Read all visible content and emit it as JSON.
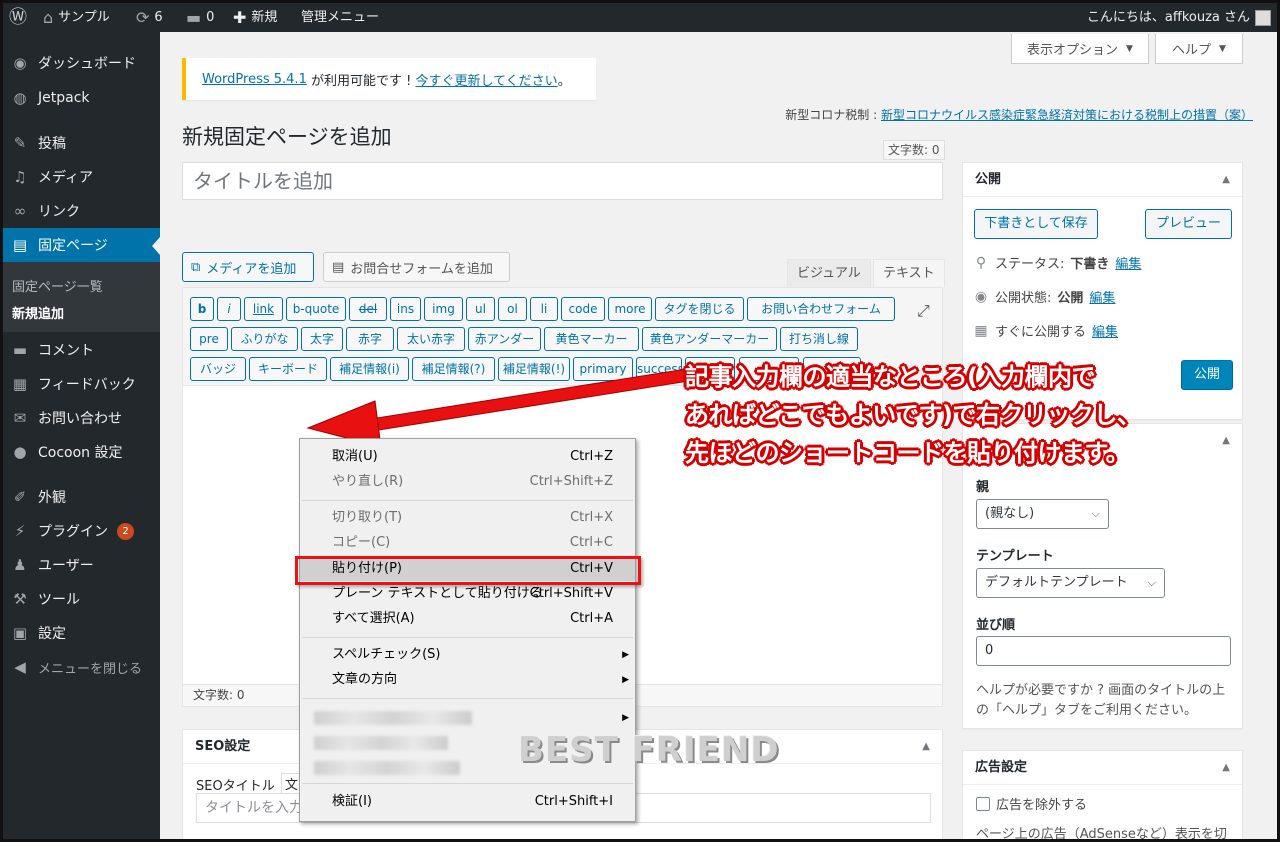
{
  "adminbar": {
    "site_name": "サンプル",
    "updates_count": "6",
    "comments_count": "0",
    "new_label": "新規",
    "admin_menu_label": "管理メニュー",
    "greeting": "こんにちは、affkouza さん"
  },
  "sidebar": {
    "items": [
      {
        "label": "ダッシュボード",
        "icon": "dashboard-icon"
      },
      {
        "label": "Jetpack",
        "icon": "jetpack-icon"
      },
      {
        "label": "投稿",
        "icon": "pin-icon"
      },
      {
        "label": "メディア",
        "icon": "media-icon"
      },
      {
        "label": "リンク",
        "icon": "link-icon"
      },
      {
        "label": "固定ページ",
        "icon": "page-icon"
      },
      {
        "label": "コメント",
        "icon": "comment-icon"
      },
      {
        "label": "フィードバック",
        "icon": "feedback-icon"
      },
      {
        "label": "お問い合わせ",
        "icon": "mail-icon"
      },
      {
        "label": "Cocoon 設定",
        "icon": "cocoon-icon"
      },
      {
        "label": "外観",
        "icon": "appearance-icon"
      },
      {
        "label": "プラグイン",
        "icon": "plugin-icon",
        "badge": "2"
      },
      {
        "label": "ユーザー",
        "icon": "user-icon"
      },
      {
        "label": "ツール",
        "icon": "tool-icon"
      },
      {
        "label": "設定",
        "icon": "settings-icon"
      },
      {
        "label": "メニューを閉じる",
        "icon": "collapse-icon"
      }
    ],
    "submenu": [
      "固定ページ一覧",
      "新規追加"
    ]
  },
  "screen_options": {
    "label": "表示オプション",
    "help": "ヘルプ"
  },
  "notice": {
    "prefix": "WordPress 5.4.1",
    "middle": " が利用可能です ! ",
    "link": "今すぐ更新してください",
    "suffix": "。"
  },
  "tax_note": {
    "label": "新型コロナ税制 : ",
    "link": "新型コロナウイルス感染症緊急経済対策における税制上の措置（案）"
  },
  "page_title": "新規固定ページを追加",
  "word_count_top": "文字数: 0",
  "title_placeholder": "タイトルを追加",
  "media_button": "メディアを追加",
  "form_button": "お問合せフォームを追加",
  "tabs": {
    "visual": "ビジュアル",
    "text": "テキスト"
  },
  "quicktags": {
    "row1": [
      "b",
      "i",
      "link",
      "b-quote",
      "del",
      "ins",
      "img",
      "ul",
      "ol",
      "li",
      "code",
      "more",
      "タグを閉じる",
      "お問い合わせフォーム"
    ],
    "row2": [
      "pre",
      "ふりがな",
      "太字",
      "赤字",
      "太い赤字",
      "赤アンダー",
      "黄色マーカー",
      "黄色アンダーマーカー",
      "打ち消し線"
    ],
    "row3": [
      "バッジ",
      "キーボード",
      "補足情報(i)",
      "補足情報(?)",
      "補足情報(!)",
      "primary",
      "success",
      "",
      "",
      ""
    ]
  },
  "editor_footer": "文字数: 0",
  "publish": {
    "title": "公開",
    "save_draft": "下書きとして保存",
    "preview": "プレビュー",
    "status_label": "ステータス: ",
    "status_value": "下書き",
    "visibility_label": "公開状態: ",
    "visibility_value": "公開",
    "schedule_label": "すぐに公開する",
    "edit": "編集",
    "publish_button": "公開"
  },
  "page_attributes": {
    "parent_label": "親",
    "parent_value": "(親なし)",
    "template_label": "テンプレート",
    "template_value": "デフォルトテンプレート",
    "order_label": "並び順",
    "order_value": "0",
    "help_line1": "ヘルプが必要ですか ? 画面のタイトルの上",
    "help_line2": "の「ヘルプ」タブをご利用ください。"
  },
  "ad_settings": {
    "title": "広告設定",
    "exclude_label": "広告を除外する",
    "note": "ページ上の広告（AdSenseなど）表示を切"
  },
  "seo": {
    "title": "SEO設定",
    "seo_title_label": "SEOタイトル",
    "seo_title_count": "文",
    "seo_title_placeholder": "タイトルを入力"
  },
  "context_menu": {
    "undo": {
      "label": "取消(U)",
      "shortcut": "Ctrl+Z"
    },
    "redo": {
      "label": "やり直し(R)",
      "shortcut": "Ctrl+Shift+Z"
    },
    "cut": {
      "label": "切り取り(T)",
      "shortcut": "Ctrl+X"
    },
    "copy": {
      "label": "コピー(C)",
      "shortcut": "Ctrl+C"
    },
    "paste": {
      "label": "貼り付け(P)",
      "shortcut": "Ctrl+V"
    },
    "paste_plain": {
      "label": "プレーン テキストとして貼り付ける",
      "shortcut": "Ctrl+Shift+V"
    },
    "select_all": {
      "label": "すべて選択(A)",
      "shortcut": "Ctrl+A"
    },
    "spellcheck": {
      "label": "スペルチェック(S)"
    },
    "direction": {
      "label": "文章の方向"
    },
    "inspect": {
      "label": "検証(I)",
      "shortcut": "Ctrl+Shift+I"
    }
  },
  "annotation": {
    "line1": "記事入力欄の適当なところ(入力欄内で",
    "line2": "あればどこでもよいです)で右クリックし、",
    "line3": "先ほどのショートコードを貼り付けます。"
  },
  "watermark": "BEST FRIEND",
  "colors": {
    "accent": "#0073aa",
    "annotation_red": "#d40000",
    "highlight_border": "#e11111"
  }
}
